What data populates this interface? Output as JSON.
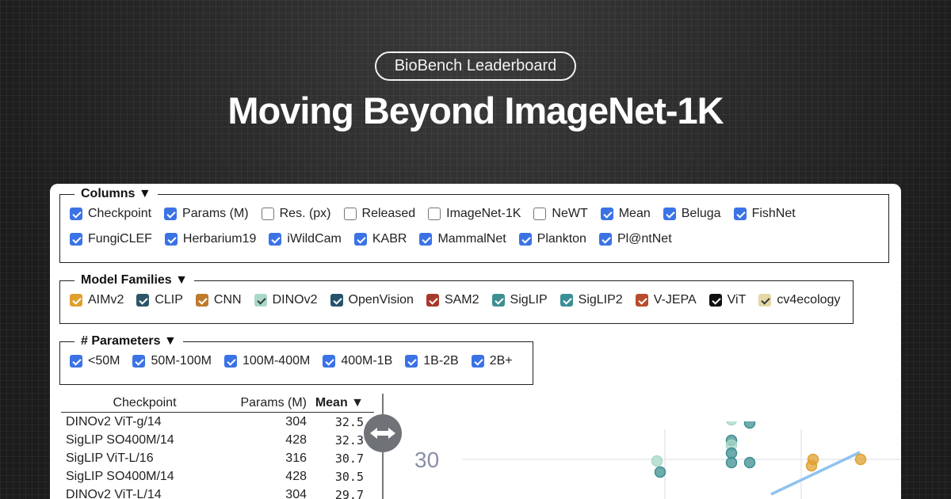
{
  "header": {
    "pill": "BioBench Leaderboard",
    "title": "Moving Beyond ImageNet-1K"
  },
  "columns": {
    "legend": "Columns ▼",
    "items": [
      {
        "label": "Checkpoint",
        "checked": true
      },
      {
        "label": "Params (M)",
        "checked": true
      },
      {
        "label": "Res. (px)",
        "checked": false
      },
      {
        "label": "Released",
        "checked": false
      },
      {
        "label": "ImageNet-1K",
        "checked": false
      },
      {
        "label": "NeWT",
        "checked": false
      },
      {
        "label": "Mean",
        "checked": true
      },
      {
        "label": "Beluga",
        "checked": true
      },
      {
        "label": "FishNet",
        "checked": true
      },
      {
        "label": "FungiCLEF",
        "checked": true
      },
      {
        "label": "Herbarium19",
        "checked": true
      },
      {
        "label": "iWildCam",
        "checked": true
      },
      {
        "label": "KABR",
        "checked": true
      },
      {
        "label": "MammalNet",
        "checked": true
      },
      {
        "label": "Plankton",
        "checked": true
      },
      {
        "label": "Pl@ntNet",
        "checked": true
      }
    ]
  },
  "families": {
    "legend": "Model Families ▼",
    "items": [
      {
        "label": "AIMv2",
        "color": "#e0a030"
      },
      {
        "label": "CLIP",
        "color": "#2c5567"
      },
      {
        "label": "CNN",
        "color": "#c07a2c"
      },
      {
        "label": "DINOv2",
        "color": "#a8d8c8"
      },
      {
        "label": "OpenVision",
        "color": "#24536a"
      },
      {
        "label": "SAM2",
        "color": "#a63a2a"
      },
      {
        "label": "SigLIP",
        "color": "#3e8f92"
      },
      {
        "label": "SigLIP2",
        "color": "#3a9096"
      },
      {
        "label": "V-JEPA",
        "color": "#b54d2b"
      },
      {
        "label": "ViT",
        "color": "#111111"
      },
      {
        "label": "cv4ecology",
        "color": "#e4d9a6"
      }
    ]
  },
  "params": {
    "legend": "# Parameters ▼",
    "items": [
      {
        "label": "<50M",
        "checked": true
      },
      {
        "label": "50M-100M",
        "checked": true
      },
      {
        "label": "100M-400M",
        "checked": true
      },
      {
        "label": "400M-1B",
        "checked": true
      },
      {
        "label": "1B-2B",
        "checked": true
      },
      {
        "label": "2B+",
        "checked": true
      }
    ]
  },
  "table": {
    "headers": [
      "Checkpoint",
      "Params (M)",
      "Mean ▼"
    ],
    "rows": [
      [
        "DINOv2 ViT-g/14",
        "304",
        "32.5"
      ],
      [
        "SigLIP SO400M/14",
        "428",
        "32.3"
      ],
      [
        "SigLIP ViT-L/16",
        "316",
        "30.7"
      ],
      [
        "SigLIP SO400M/14",
        "428",
        "30.5"
      ],
      [
        "DINOv2 ViT-L/14",
        "304",
        "29.7"
      ]
    ]
  },
  "chart_data": {
    "type": "scatter",
    "y_tick_label": "30",
    "grid": true,
    "points": [
      {
        "family": "DINOv2",
        "y": 32.5
      },
      {
        "family": "SigLIP",
        "y": 32.3
      },
      {
        "family": "SigLIP",
        "y": 31.2
      },
      {
        "family": "DINOv2",
        "y": 30.9
      },
      {
        "family": "SigLIP",
        "y": 30.4
      },
      {
        "family": "SigLIP",
        "y": 29.8
      },
      {
        "family": "DINOv2",
        "y": 29.9
      },
      {
        "family": "SigLIP",
        "y": 29.2
      },
      {
        "family": "SigLIP",
        "y": 29.8
      },
      {
        "family": "AIMv2",
        "y": 30.0
      },
      {
        "family": "AIMv2",
        "y": 29.6
      },
      {
        "family": "AIMv2",
        "y": 30.0
      }
    ]
  }
}
